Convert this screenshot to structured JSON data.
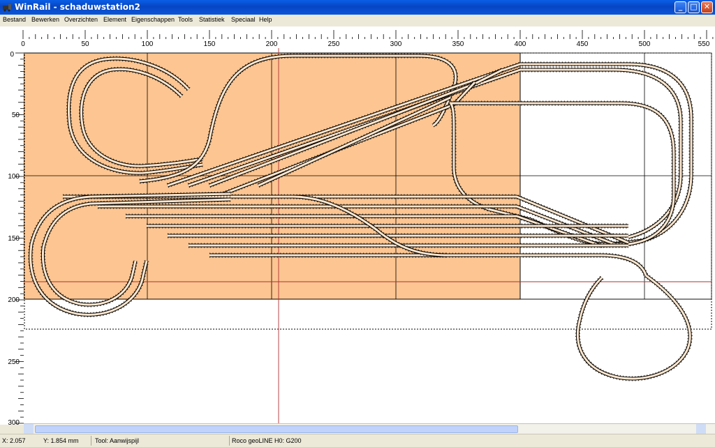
{
  "window": {
    "title": "WinRail - schaduwstation2",
    "app_icon": "winrail-app-icon",
    "controls": {
      "minimize": "_",
      "maximize": "□",
      "close": "✕"
    }
  },
  "menu": [
    {
      "label": "Bestand"
    },
    {
      "label": "Bewerken"
    },
    {
      "label": "Overzichten"
    },
    {
      "label": "Element"
    },
    {
      "label": "Eigenschappen"
    },
    {
      "label": "Tools"
    },
    {
      "label": "Statistiek"
    },
    {
      "label": "Speciaal"
    },
    {
      "label": "Help"
    }
  ],
  "ruler": {
    "horizontal_labels": [
      "0",
      "50",
      "100",
      "150",
      "200",
      "250",
      "300",
      "350",
      "400",
      "450",
      "500",
      "550"
    ],
    "vertical_labels": [
      "0",
      "50",
      "100",
      "150",
      "200",
      "250",
      "300"
    ],
    "unit": "mm"
  },
  "layout": {
    "baseboard_color": "#fcc591",
    "track_color": "#000000",
    "crosshair_color": "#b03030"
  },
  "status": {
    "x": "X: 2.057",
    "y": "Y: 1.854 mm",
    "tool": "Tool: Aanwijspijl",
    "track_system": "Roco geoLINE H0: G200"
  }
}
